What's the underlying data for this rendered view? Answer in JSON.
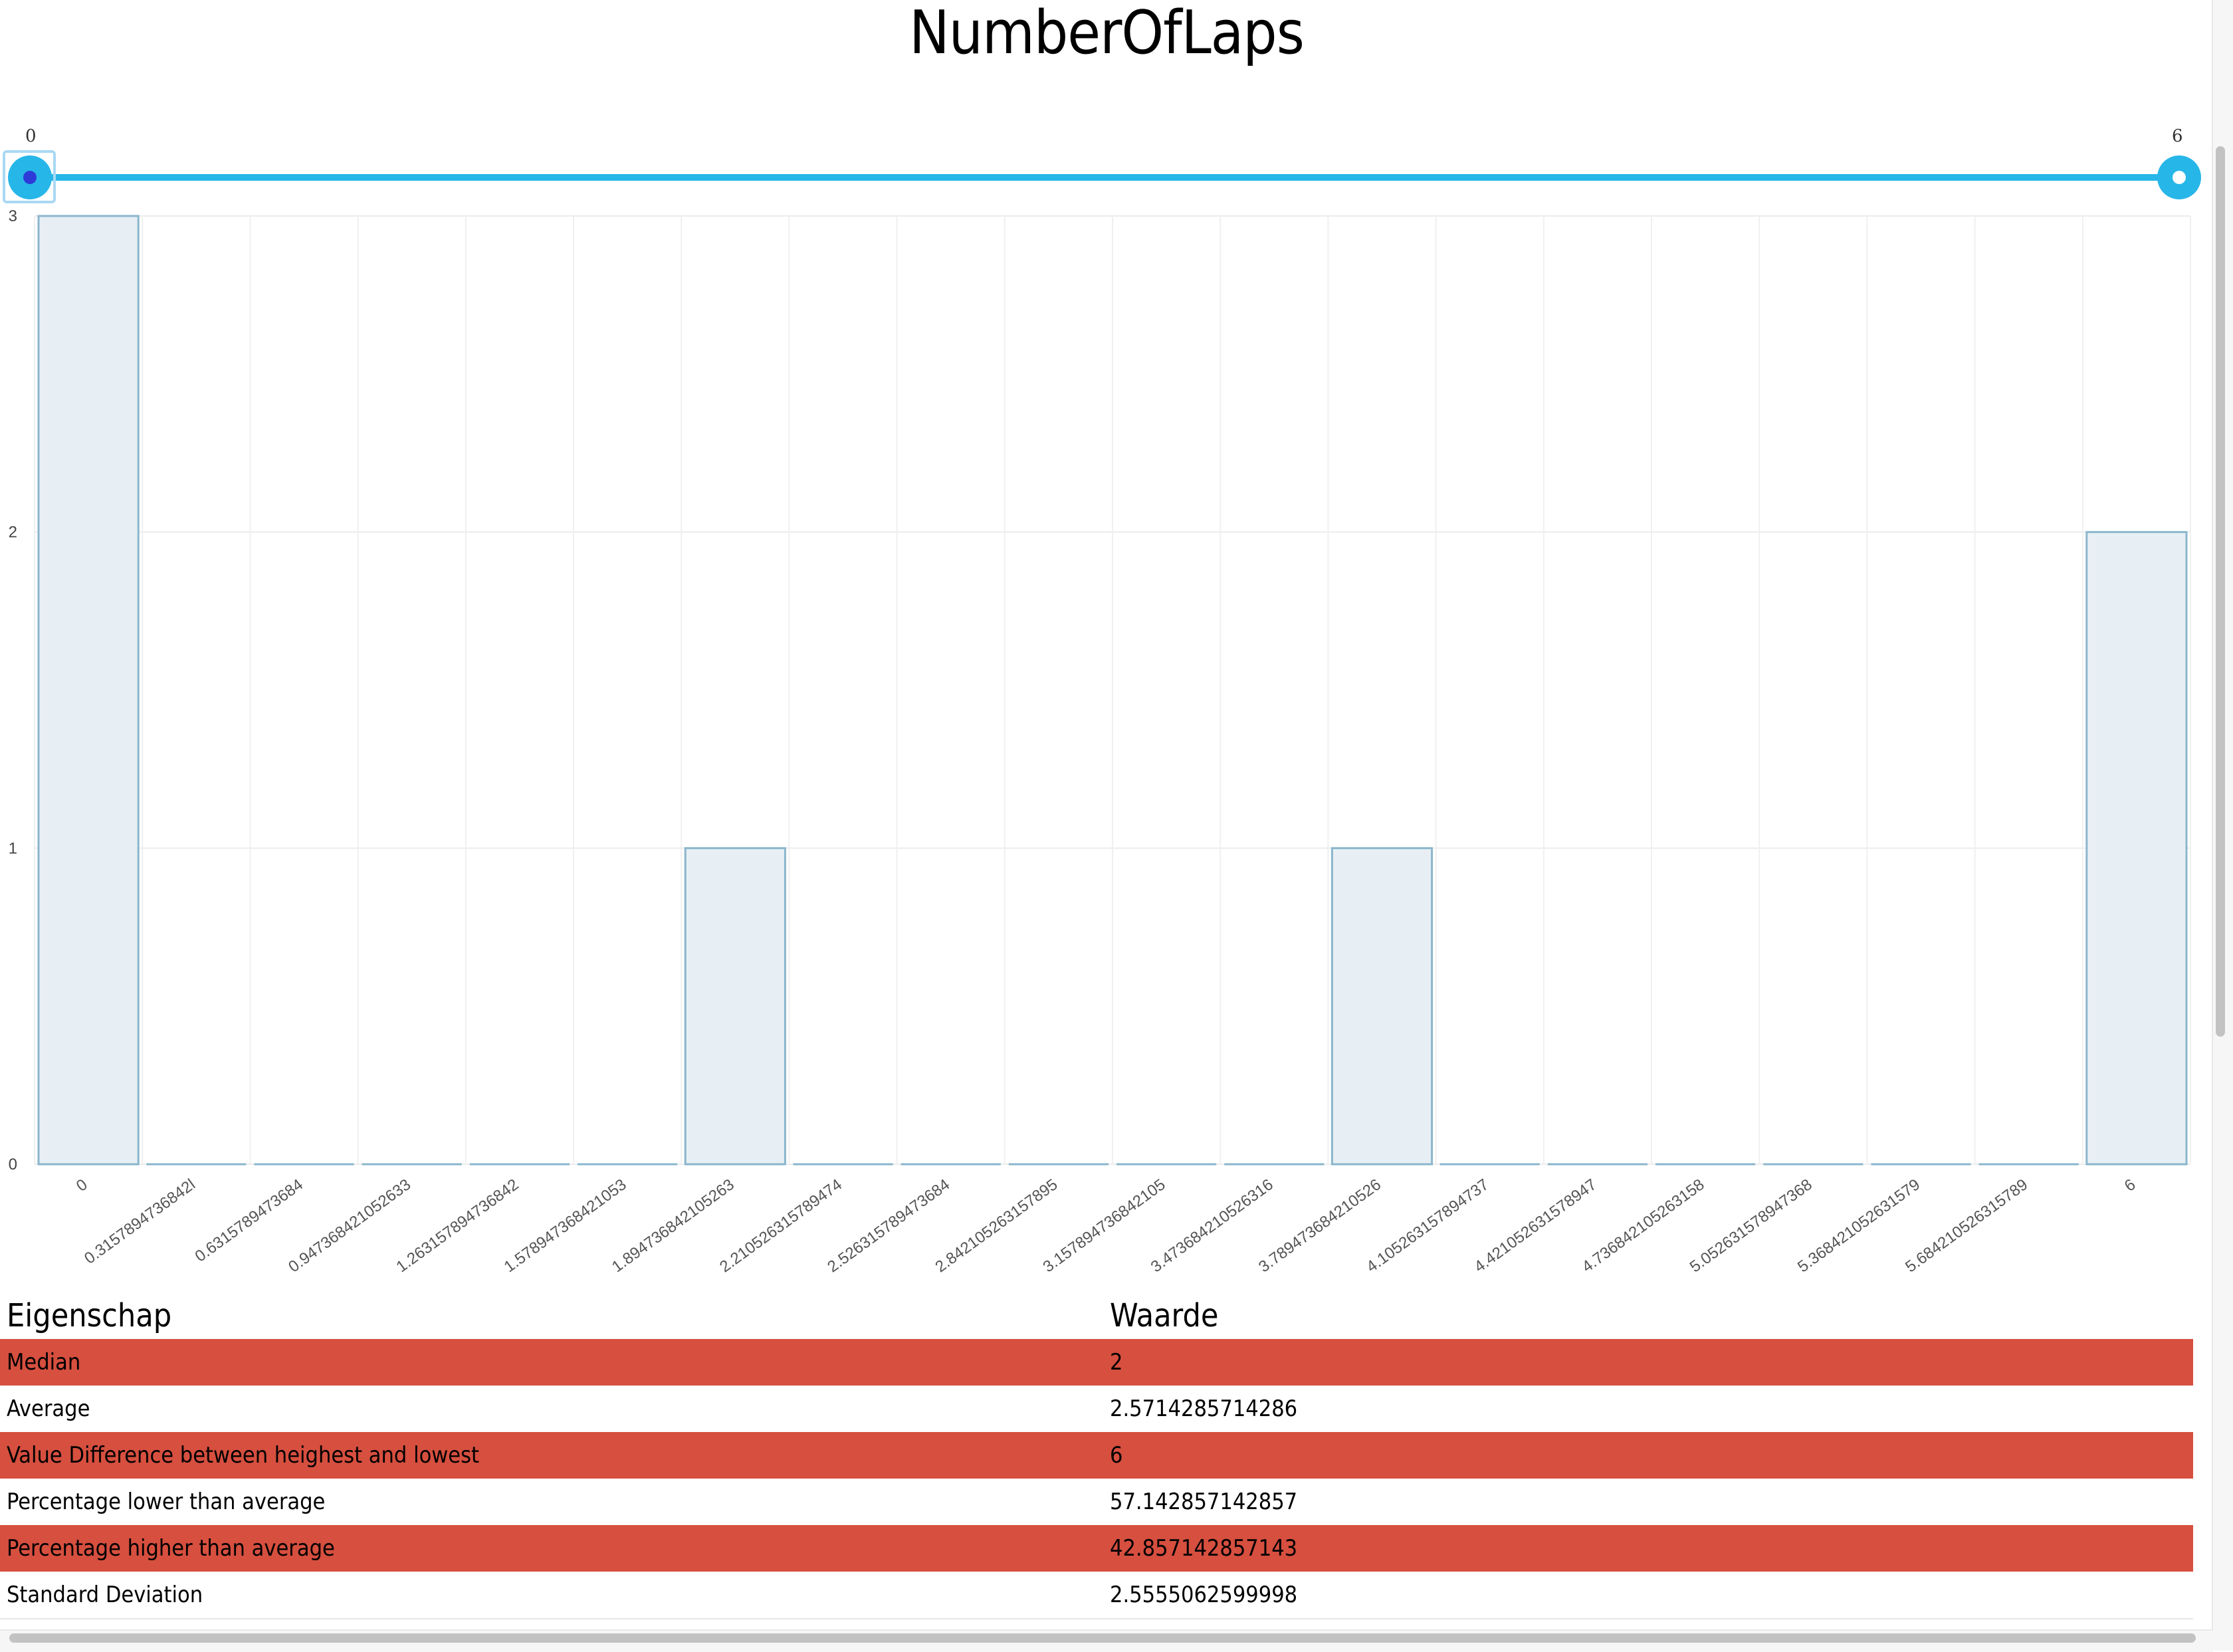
{
  "title": "NumberOfLaps",
  "slider": {
    "min_value": "0",
    "max_value": "6",
    "min_position": 0,
    "max_position": 6,
    "track_color": "#27b6e8"
  },
  "chart_data": {
    "type": "bar",
    "categories": [
      "0",
      "0.3157894736842l",
      "0.6315789473684",
      "0.947368421052633",
      "1.263157894736842",
      "1.578947368421053",
      "1.894736842105263",
      "2.210526315789474",
      "2.526315789473684",
      "2.842105263157895",
      "3.157894736842105",
      "3.473684210526316",
      "3.789473684210526",
      "4.105263157894737",
      "4.421052631578947",
      "4.736842105263158",
      "5.052631578947368",
      "5.368421052631579",
      "5.684210526315789",
      "6"
    ],
    "tick_labels": [
      "0",
      "0.3157894736842l",
      "0.6315789473684",
      "0.947368421052633",
      "1.263157894736842",
      "1.578947368421053",
      "1.894736842105263",
      "2.210526315789474",
      "2.526315789473684",
      "2.842105263157895",
      "3.157894736842105",
      "3.473684210526316",
      "3.789473684210526",
      "4.105263157894737",
      "4.421052631578947",
      "4.736842105263158",
      "5.052631578947368",
      "5.368421052631579",
      "5.684210526315789",
      "6"
    ],
    "values": [
      3,
      0,
      0,
      0,
      0,
      0,
      1,
      0,
      0,
      0,
      0,
      0,
      1,
      0,
      0,
      0,
      0,
      0,
      0,
      2
    ],
    "ylim": [
      0,
      3
    ],
    "yticks": [
      "0",
      "1",
      "2",
      "3"
    ],
    "xlabel": "",
    "ylabel": "",
    "grid": true,
    "bar_fill": "#e8eff4",
    "bar_stroke": "#8ab6cc"
  },
  "table": {
    "headers": [
      "Eigenschap",
      "Waarde"
    ],
    "rows": [
      {
        "property": "Median",
        "value": "2"
      },
      {
        "property": "Average",
        "value": "2.5714285714286"
      },
      {
        "property": "Value Difference between heighest and lowest",
        "value": "6"
      },
      {
        "property": "Percentage lower than average",
        "value": "57.142857142857"
      },
      {
        "property": "Percentage higher than average",
        "value": "42.857142857143"
      },
      {
        "property": "Standard Deviation",
        "value": "2.5555062599998"
      }
    ],
    "highlight_color": "#d64f3f"
  }
}
